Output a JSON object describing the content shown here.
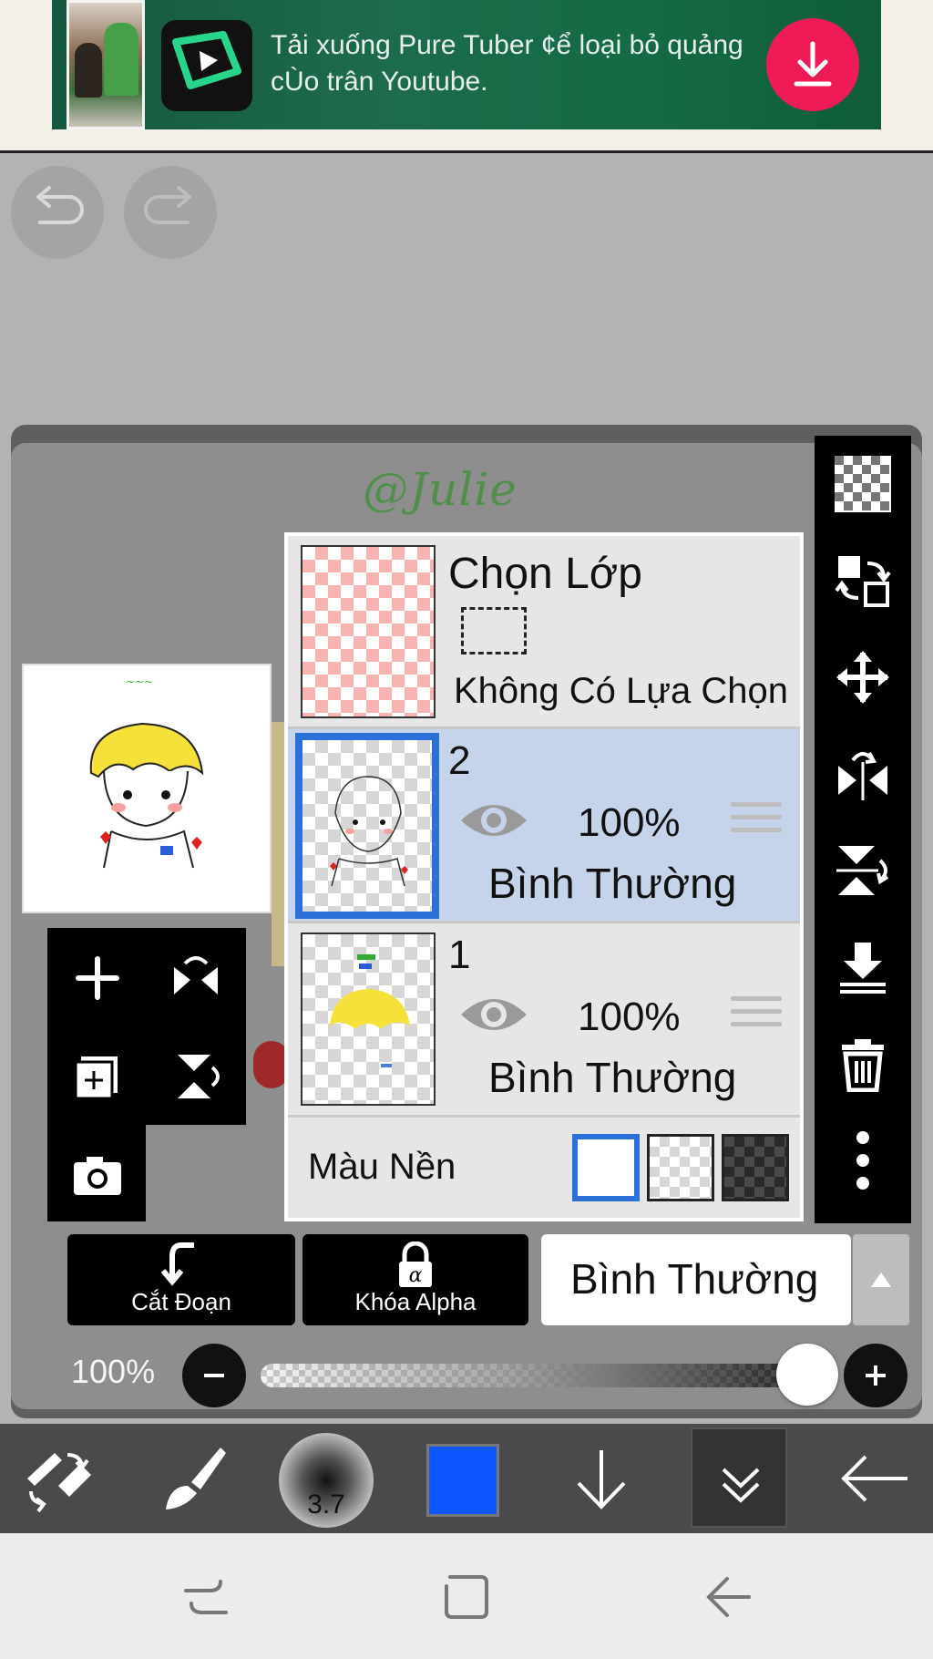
{
  "ad": {
    "text": "Tải xuống Pure Tuber ¢ể loại bỏ quảng cÙo trân Youtube.",
    "accent_color": "#ee1b57",
    "icons": [
      "app-logo-icon",
      "download-icon"
    ]
  },
  "history": {
    "undo_icon": "undo-icon",
    "redo_icon": "redo-icon"
  },
  "canvas": {
    "signature": "@Julie"
  },
  "layers_panel": {
    "selection_layer": {
      "title": "Chọn Lớp",
      "status": "Không Có Lựa Chọn"
    },
    "layers": [
      {
        "number": "2",
        "opacity": "100%",
        "blend_mode": "Bình Thường",
        "selected": true
      },
      {
        "number": "1",
        "opacity": "100%",
        "blend_mode": "Bình Thường",
        "selected": false
      }
    ],
    "background": {
      "label": "Màu Nền",
      "options": [
        "white",
        "transparent",
        "dark"
      ],
      "selected": "white"
    },
    "selected_color": "#2b6fd8"
  },
  "layer_actions": {
    "cut_label": "Cắt Đoạn",
    "alpha_lock_label": "Khóa Alpha",
    "blend_mode_value": "Bình Thường"
  },
  "opacity": {
    "label": "100%",
    "value": 1.0
  },
  "bottom_toolbar": {
    "brush_size": "3.7",
    "current_color": "#0f56ff"
  }
}
